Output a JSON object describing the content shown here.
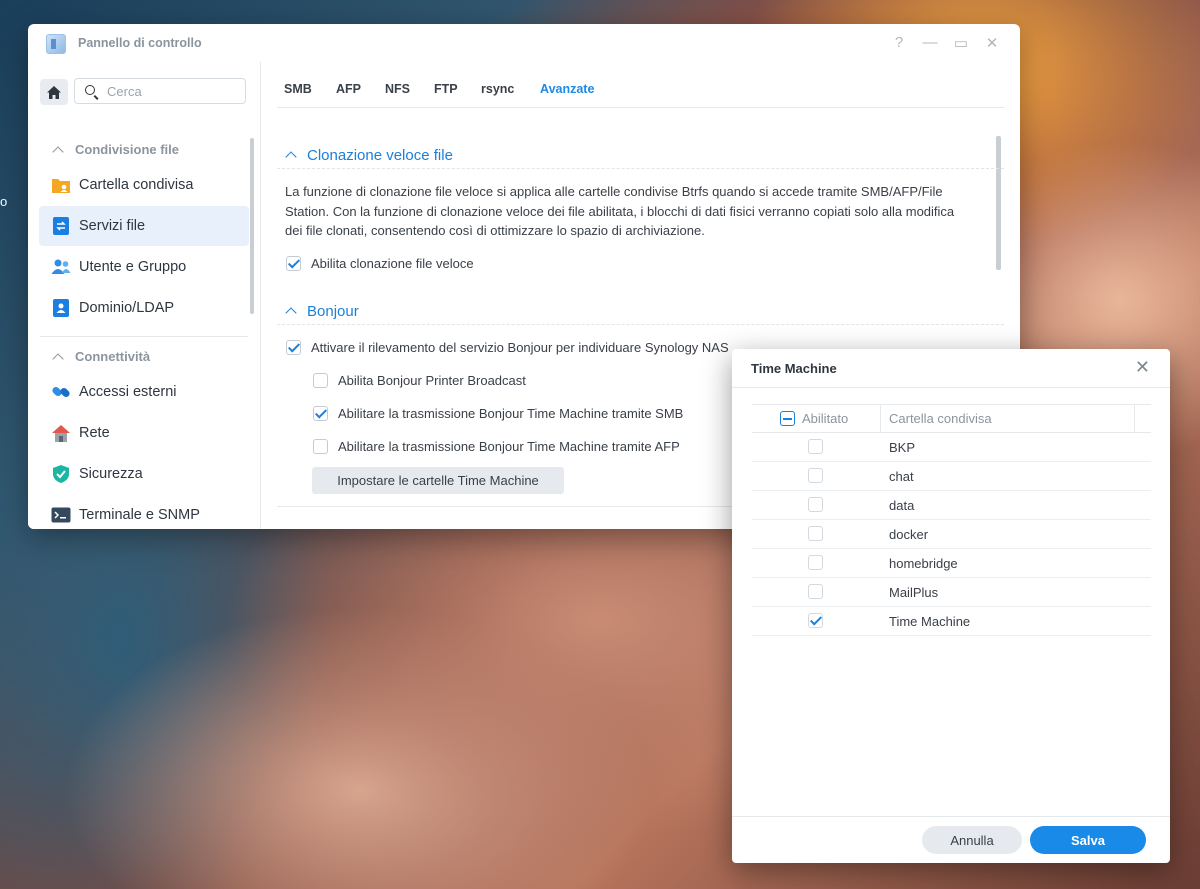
{
  "desktop": {
    "edge_text": "o"
  },
  "window": {
    "title": "Pannello di controllo",
    "controls": {
      "help": "?",
      "minimize": "—",
      "maximize": "▭",
      "close": "✕"
    }
  },
  "sidebar": {
    "search_placeholder": "Cerca",
    "sections": [
      {
        "label": "Condivisione file",
        "items": [
          "Cartella condivisa",
          "Servizi file",
          "Utente e Gruppo",
          "Dominio/LDAP"
        ]
      },
      {
        "label": "Connettività",
        "items": [
          "Accessi esterni",
          "Rete",
          "Sicurezza",
          "Terminale e SNMP"
        ]
      }
    ],
    "active_item": "Servizi file"
  },
  "tabs": [
    "SMB",
    "AFP",
    "NFS",
    "FTP",
    "rsync",
    "Avanzate"
  ],
  "active_tab": "Avanzate",
  "fast_clone": {
    "title": "Clonazione veloce file",
    "description": "La funzione di clonazione file veloce si applica alle cartelle condivise Btrfs quando si accede tramite SMB/AFP/File Station. Con la funzione di clonazione veloce dei file abilitata, i blocchi di dati fisici verranno copiati solo alla modifica dei file clonati, consentendo così di ottimizzare lo spazio di archiviazione.",
    "checkbox_label": "Abilita clonazione file veloce",
    "checked": true
  },
  "bonjour": {
    "title": "Bonjour",
    "options": [
      {
        "label": "Attivare il rilevamento del servizio Bonjour per individuare Synology NAS",
        "checked": true
      },
      {
        "label": "Abilita Bonjour Printer Broadcast",
        "checked": false
      },
      {
        "label": "Abilitare la trasmissione Bonjour Time Machine tramite SMB",
        "checked": true
      },
      {
        "label": "Abilitare la trasmissione Bonjour Time Machine tramite AFP",
        "checked": false
      }
    ],
    "button_label": "Impostare le cartelle Time Machine"
  },
  "dialog": {
    "title": "Time Machine",
    "columns": [
      "Abilitato",
      "Cartella condivisa"
    ],
    "rows": [
      {
        "name": "BKP",
        "enabled": false
      },
      {
        "name": "chat",
        "enabled": false
      },
      {
        "name": "data",
        "enabled": false
      },
      {
        "name": "docker",
        "enabled": false
      },
      {
        "name": "homebridge",
        "enabled": false
      },
      {
        "name": "MailPlus",
        "enabled": false
      },
      {
        "name": "Time Machine",
        "enabled": true
      }
    ],
    "cancel_label": "Annulla",
    "save_label": "Salva"
  },
  "colors": {
    "accent": "#1a8ae9",
    "link": "#1c7fd9",
    "active_nav_bg": "#e8f0fb"
  }
}
